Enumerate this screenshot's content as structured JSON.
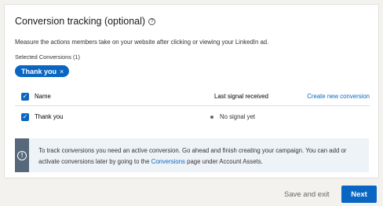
{
  "section": {
    "title": "Conversion tracking (optional)",
    "help_icon": "?",
    "description": "Measure the actions members take on your website after clicking or viewing your LinkedIn ad.",
    "selected_label": "Selected Conversions (1)"
  },
  "selected_pill": {
    "label": "Thank you",
    "close": "×"
  },
  "table": {
    "headers": {
      "name": "Name",
      "signal": "Last signal received",
      "action": "Create new conversion"
    },
    "rows": [
      {
        "name": "Thank you",
        "status": "No signal yet"
      }
    ]
  },
  "info": {
    "icon": "!",
    "text_before": "To track conversions you need an active conversion. Go ahead and finish creating your campaign. You can add or activate conversions later by going to the ",
    "link": "Conversions",
    "text_after": " page under Account Assets."
  },
  "footer": {
    "save_exit": "Save and exit",
    "next": "Next"
  },
  "colors": {
    "primary": "#0a66c2",
    "info_bg": "#eef3f8",
    "info_bar": "#56687a"
  }
}
